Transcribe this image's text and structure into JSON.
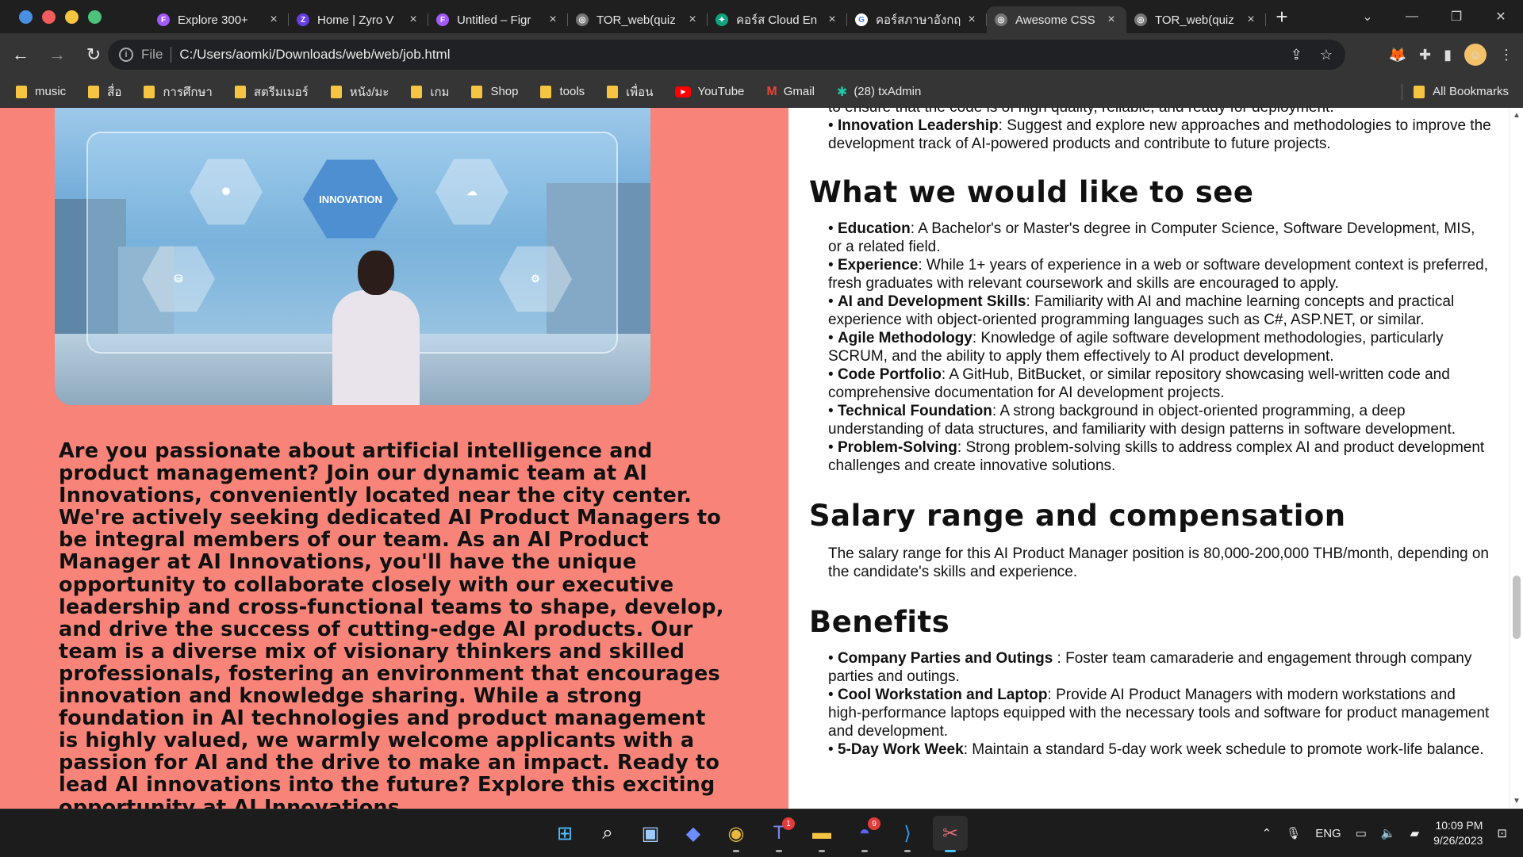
{
  "window": {
    "dot_colors": [
      "#4a90e2",
      "#f25c5c",
      "#f5c542",
      "#4cc27a"
    ],
    "tabs": [
      {
        "title": "Explore 300+",
        "favicon": "figma-icon",
        "favicon_color": "#a259ff",
        "favicon_glyph": "F"
      },
      {
        "title": "Home | Zyro V",
        "favicon": "zyro-icon",
        "favicon_color": "#673de6",
        "favicon_glyph": "Z"
      },
      {
        "title": "Untitled – Figr",
        "favicon": "figma-icon",
        "favicon_color": "#a259ff",
        "favicon_glyph": "F"
      },
      {
        "title": "TOR_web(quiz",
        "favicon": "globe-icon",
        "favicon_color": "#777777",
        "favicon_glyph": "◎"
      },
      {
        "title": "คอร์ส Cloud En",
        "favicon": "chatgpt-icon",
        "favicon_color": "#10a37f",
        "favicon_glyph": "✦"
      },
      {
        "title": "คอร์สภาษาอังกฤ",
        "favicon": "google-icon",
        "favicon_color": "#ffffff",
        "favicon_glyph": "G"
      },
      {
        "title": "Awesome CSS",
        "favicon": "globe-icon",
        "favicon_color": "#777777",
        "favicon_glyph": "◎",
        "active": true
      },
      {
        "title": "TOR_web(quiz",
        "favicon": "globe-icon",
        "favicon_color": "#777777",
        "favicon_glyph": "◎"
      }
    ],
    "new_tab": "+"
  },
  "toolbar": {
    "scheme": "File",
    "url": "C:/Users/aomki/Downloads/web/web/job.html"
  },
  "bookmarks": {
    "items": [
      {
        "label": "music",
        "icon": "folder-icon"
      },
      {
        "label": "สื่อ",
        "icon": "folder-icon"
      },
      {
        "label": "การศึกษา",
        "icon": "folder-icon"
      },
      {
        "label": "สตรีมเมอร์",
        "icon": "folder-icon"
      },
      {
        "label": "หนัง/มะ",
        "icon": "folder-icon"
      },
      {
        "label": "เกม",
        "icon": "folder-icon"
      },
      {
        "label": "Shop",
        "icon": "folder-icon"
      },
      {
        "label": "tools",
        "icon": "folder-icon"
      },
      {
        "label": "เพื่อน",
        "icon": "folder-icon"
      },
      {
        "label": "YouTube",
        "icon": "youtube-icon"
      },
      {
        "label": "Gmail",
        "icon": "gmail-icon"
      },
      {
        "label": "(28) txAdmin",
        "icon": "txadmin-icon"
      }
    ],
    "all_bookmarks": "All Bookmarks"
  },
  "page": {
    "left_bg": "#f88379",
    "hero_label": "INNOVATION",
    "intro": "Are you passionate about artificial intelligence and product management? Join our dynamic team at AI Innovations, conveniently located near the city center. We're actively seeking dedicated AI Product Managers to be integral members of our team. As an AI Product Manager at AI Innovations, you'll have the unique opportunity to collaborate closely with our executive leadership and cross-functional teams to shape, develop, and drive the success of cutting-edge AI products. Our team is a diverse mix of visionary thinkers and skilled professionals, fostering an environment that encourages innovation and knowledge sharing. While a strong foundation in AI technologies and product management is highly valued, we warmly welcome applicants with a passion for AI and the drive to make an impact. Ready to lead AI innovations into the future? Explore this exciting opportunity at AI Innovations.",
    "top_fragment": "to ensure that the code is of high quality, reliable, and ready for deployment.",
    "top_item": {
      "label": "Innovation Leadership",
      "text": ": Suggest and explore new approaches and methodologies to improve the development track of AI-powered products and contribute to future projects."
    },
    "sections": {
      "see_title": "What we would like to see",
      "see_items": [
        {
          "label": "Education",
          "text": ": A Bachelor's or Master's degree in Computer Science, Software Development, MIS, or a related field."
        },
        {
          "label": "Experience",
          "text": ": While 1+ years of experience in a web or software development context is preferred, fresh graduates with relevant coursework and skills are encouraged to apply."
        },
        {
          "label": "AI and Development Skills",
          "text": ": Familiarity with AI and machine learning concepts and practical experience with object-oriented programming languages such as C#, ASP.NET, or similar."
        },
        {
          "label": "Agile Methodology",
          "text": ": Knowledge of agile software development methodologies, particularly SCRUM, and the ability to apply them effectively to AI product development."
        },
        {
          "label": "Code Portfolio",
          "text": ": A GitHub, BitBucket, or similar repository showcasing well-written code and comprehensive documentation for AI development projects."
        },
        {
          "label": "Technical Foundation",
          "text": ": A strong background in object-oriented programming, a deep understanding of data structures, and familiarity with design patterns in software development."
        },
        {
          "label": "Problem-Solving",
          "text": ": Strong problem-solving skills to address complex AI and product development challenges and create innovative solutions."
        }
      ],
      "salary_title": "Salary range and compensation",
      "salary_text": "The salary range for this AI Product Manager position is 80,000-200,000 THB/month, depending on the candidate's skills and experience.",
      "benefits_title": "Benefits",
      "benefit_items": [
        {
          "label": "Company Parties and Outings",
          "text": " : Foster team camaraderie and engagement through company parties and outings."
        },
        {
          "label": "Cool Workstation and Laptop",
          "text": ": Provide AI Product Managers with modern workstations and high-performance laptops equipped with the necessary tools and software for product management and development."
        },
        {
          "label": "5-Day Work Week",
          "text": ": Maintain a standard 5-day work week schedule to promote work-life balance."
        }
      ]
    }
  },
  "taskbar": {
    "apps": [
      {
        "name": "start-icon",
        "glyph": "⊞",
        "color": "#4cc2ff"
      },
      {
        "name": "search-icon",
        "glyph": "⌕",
        "color": "#ffffff"
      },
      {
        "name": "task-view-icon",
        "glyph": "▣",
        "color": "#9ecbff"
      },
      {
        "name": "copilot-icon",
        "glyph": "◆",
        "color": "#6d8cff"
      },
      {
        "name": "chrome-icon",
        "glyph": "◉",
        "color": "#e9b83c",
        "running": true
      },
      {
        "name": "teams-icon",
        "glyph": "T",
        "color": "#7b83eb",
        "badge": "1",
        "running": true
      },
      {
        "name": "file-explorer-icon",
        "glyph": "▬",
        "color": "#f5c542",
        "running": true
      },
      {
        "name": "discord-icon",
        "glyph": "◓",
        "color": "#5865f2",
        "badge": "9",
        "running": true
      },
      {
        "name": "vscode-icon",
        "glyph": "⟩",
        "color": "#2f9bf0",
        "running": true
      },
      {
        "name": "snipping-tool-icon",
        "glyph": "✂",
        "color": "#e06c75",
        "focused": true
      }
    ],
    "language": "ENG",
    "time": "10:09 PM",
    "date": "9/26/2023"
  }
}
